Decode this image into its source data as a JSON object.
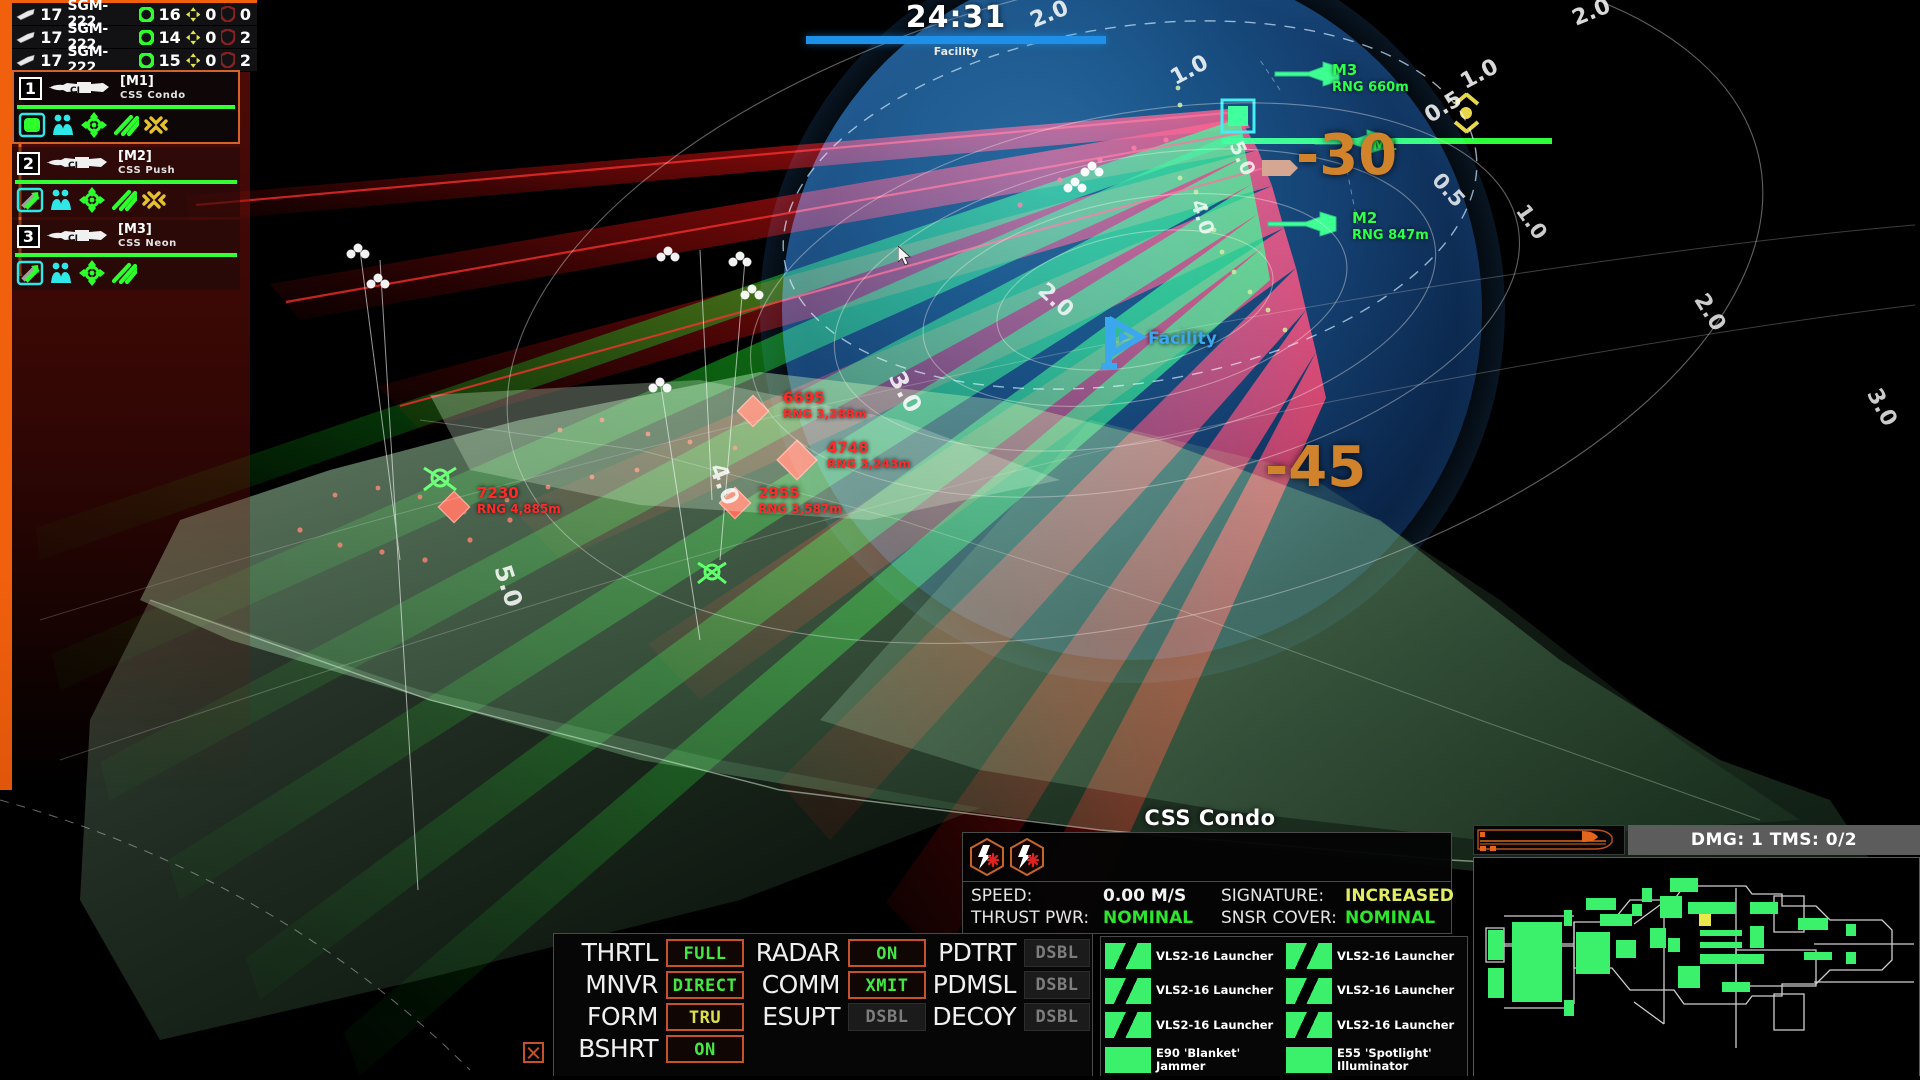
{
  "mission": {
    "timer": "24:31",
    "objective_label": "Facility",
    "objective_progress_pct": 100
  },
  "salvos": [
    {
      "icon": "missile-icon",
      "count": "17",
      "designation": "SGM-222",
      "track_icon": "green-ring-icon",
      "tracked": "16",
      "spread_icon": "spread-icon",
      "spread": "0",
      "shield_icon": "shield-icon",
      "intercepted": "0"
    },
    {
      "icon": "missile-icon",
      "count": "17",
      "designation": "SGM-222",
      "track_icon": "green-ring-icon",
      "tracked": "14",
      "spread_icon": "spread-icon",
      "spread": "0",
      "shield_icon": "shield-icon",
      "intercepted": "2"
    },
    {
      "icon": "missile-icon",
      "count": "17",
      "designation": "SGM-222",
      "track_icon": "green-ring-icon",
      "tracked": "15",
      "spread_icon": "spread-icon",
      "spread": "0",
      "shield_icon": "shield-icon",
      "intercepted": "2"
    }
  ],
  "roster": [
    {
      "number": "1",
      "tag": "[M1]",
      "ship": "CSS Condo",
      "selected": true,
      "hull_pct": 100,
      "icons": [
        "status-ok-icon",
        "crew-icon",
        "targeting-icon",
        "weapons-icon",
        "sensor-icon"
      ]
    },
    {
      "number": "2",
      "tag": "[M2]",
      "ship": "CSS Push",
      "selected": false,
      "hull_pct": 100,
      "icons": [
        "move-order-icon",
        "crew-icon",
        "targeting-icon",
        "weapons-icon",
        "sensor-icon"
      ]
    },
    {
      "number": "3",
      "tag": "[M3]",
      "ship": "CSS Neon",
      "selected": false,
      "hull_pct": 100,
      "icons": [
        "move-order-icon",
        "crew-icon",
        "targeting-icon",
        "weapons-icon"
      ]
    }
  ],
  "friendly_contacts": [
    {
      "id": "M3",
      "range": "RNG 660m"
    },
    {
      "id": "M1",
      "range": ""
    },
    {
      "id": "M2",
      "range": "RNG 847m"
    }
  ],
  "hostile_contacts": [
    {
      "id": "6695",
      "range": "RNG 3,288m"
    },
    {
      "id": "4748",
      "range": "RNG 3,243m"
    },
    {
      "id": "2955",
      "range": "RNG 3,587m"
    },
    {
      "id": "7230",
      "range": "RNG 4,885m"
    }
  ],
  "waypoints": [
    {
      "label": "Facility",
      "icon": "flag-icon"
    }
  ],
  "bearings": [
    {
      "value": "-30"
    },
    {
      "value": "-45"
    }
  ],
  "ring_labels": [
    "2.0",
    "1.0",
    "0.5",
    "5.0",
    "4.0",
    "3.0",
    "2.0",
    "0.5",
    "1.0",
    "2.0",
    "3.0",
    "5.0",
    "2.0",
    "1.0",
    "0.5"
  ],
  "systems": {
    "rows": [
      [
        {
          "label": "THRTL",
          "value": "FULL",
          "state": "on"
        },
        {
          "label": "RADAR",
          "value": "ON",
          "state": "on"
        },
        {
          "label": "PDTRT",
          "value": "DSBL",
          "state": "off"
        }
      ],
      [
        {
          "label": "MNVR",
          "value": "DIRECT",
          "state": "on"
        },
        {
          "label": "COMM",
          "value": "XMIT",
          "state": "on"
        },
        {
          "label": "PDMSL",
          "value": "DSBL",
          "state": "off"
        }
      ],
      [
        {
          "label": "FORM",
          "value": "TRU",
          "state": "warn"
        },
        {
          "label": "ESUPT",
          "value": "DSBL",
          "state": "off"
        },
        {
          "label": "DECOY",
          "value": "DSBL",
          "state": "off"
        }
      ],
      [
        {
          "label": "BSHRT",
          "value": "ON",
          "state": "on"
        },
        {
          "label": "",
          "value": "",
          "state": "blank"
        },
        {
          "label": "",
          "value": "",
          "state": "blank"
        }
      ]
    ]
  },
  "ship_status": {
    "name": "CSS Condo",
    "effects": [
      "emissions-warning-icon",
      "emissions-warning-icon"
    ],
    "stats": [
      {
        "key": "SPEED:",
        "value": "0.00 M/S",
        "tone": "white"
      },
      {
        "key": "SIGNATURE:",
        "value": "INCREASED",
        "tone": "yellow"
      },
      {
        "key": "THRUST PWR:",
        "value": "NOMINAL",
        "tone": "green"
      },
      {
        "key": "SNSR COVER:",
        "value": "NOMINAL",
        "tone": "green"
      }
    ]
  },
  "mounts": [
    {
      "name": "VLS2-16 Launcher",
      "style": "striped"
    },
    {
      "name": "VLS2-16 Launcher",
      "style": "striped"
    },
    {
      "name": "VLS2-16 Launcher",
      "style": "striped"
    },
    {
      "name": "VLS2-16 Launcher",
      "style": "striped"
    },
    {
      "name": "VLS2-16 Launcher",
      "style": "striped"
    },
    {
      "name": "VLS2-16 Launcher",
      "style": "striped"
    },
    {
      "name": "E90 'Blanket' Jammer",
      "style": "solid"
    },
    {
      "name": "E55 'Spotlight' Illuminator",
      "style": "solid"
    }
  ],
  "damage": {
    "summary": "DMG: 1 TMS: 0/2"
  },
  "colors": {
    "accent_orange": "#f1600d",
    "friendly_green": "#2dff4a",
    "hostile_red": "#ff2a2a",
    "waypoint_blue": "#3ba7ef",
    "bearing_orange": "#d1832b",
    "timer_blue": "#1e90e8",
    "panel_bg": "#060606",
    "panel_border": "#4a4a4a"
  }
}
